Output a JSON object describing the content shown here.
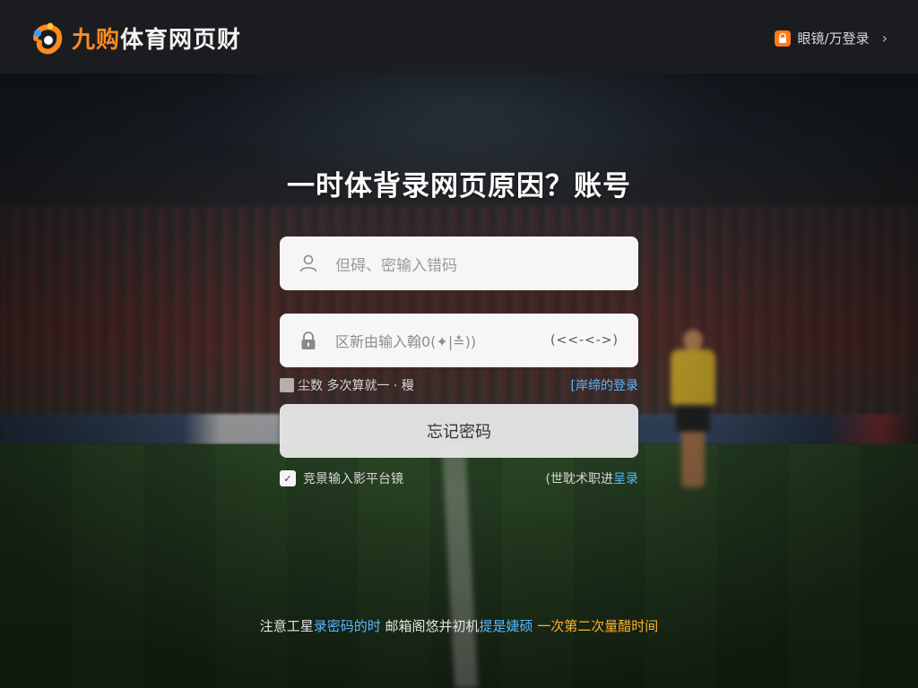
{
  "header": {
    "logo_text_part1": "九购",
    "logo_text_part2": "体育网页财",
    "login_link": "眼镜/万登录",
    "login_chevron": "›"
  },
  "title": "一时体背录网页原因？账号",
  "form": {
    "username_placeholder": "但碍、密输入错码",
    "password_placeholder": "区新由输入翰0(✦|≛))",
    "password_toggle_hint": "(<<-<->)",
    "remember_label": "尘数 多次算就一 · 䅼",
    "remember_link": "[岸缔的登录",
    "submit_label": "忘记密码",
    "agree_label": "竞景输入影平台镜",
    "alt_login_prefix": "(世耽术职进",
    "alt_login_link": "呈录"
  },
  "notice": {
    "part1": "注意工星",
    "part2": "录密码的时",
    "part3": " 邮箱阁悠并初机",
    "part4": "提是婕硕",
    "part5": "  一次第二次量醋时间"
  },
  "colors": {
    "accent_orange": "#ff8a1f",
    "link_blue": "#59b8ff",
    "notice_orange": "#ffb22a"
  },
  "icons": [
    "logo-mark-icon",
    "user-icon",
    "lock-icon",
    "shield-icon",
    "check-icon"
  ]
}
